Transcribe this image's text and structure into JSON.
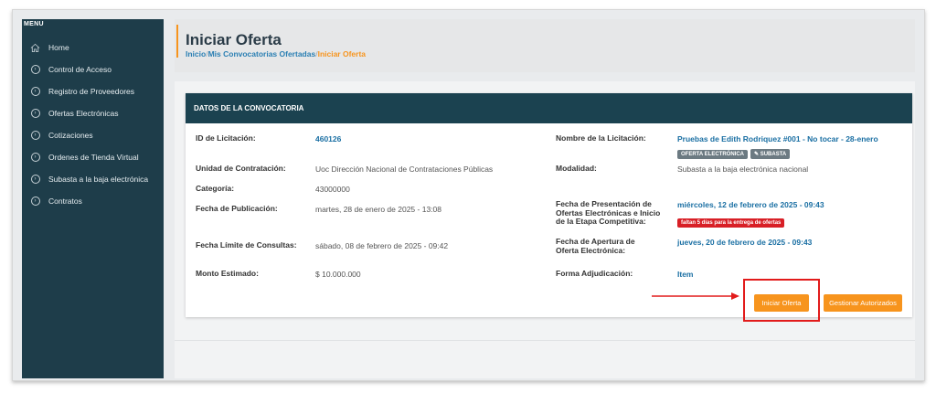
{
  "sidebar": {
    "title": "MENU",
    "items": [
      {
        "label": "Home",
        "icon": "home-icon"
      },
      {
        "label": "Control de Acceso",
        "icon": "chevron-right-circle-icon"
      },
      {
        "label": "Registro de Proveedores",
        "icon": "chevron-right-circle-icon"
      },
      {
        "label": "Ofertas Electrónicas",
        "icon": "chevron-right-circle-icon"
      },
      {
        "label": "Cotizaciones",
        "icon": "chevron-right-circle-icon"
      },
      {
        "label": "Ordenes de Tienda Virtual",
        "icon": "chevron-right-circle-icon"
      },
      {
        "label": "Subasta a la baja electrónica",
        "icon": "chevron-right-circle-icon"
      },
      {
        "label": "Contratos",
        "icon": "chevron-right-circle-icon"
      }
    ]
  },
  "header": {
    "title": "Iniciar Oferta",
    "breadcrumb": [
      "Inicio",
      "Mis Convocatorias Ofertadas",
      "Iniciar Oferta"
    ],
    "separator": "/"
  },
  "card": {
    "title": "DATOS DE LA CONVOCATORIA",
    "id_label": "ID de Licitación:",
    "id_value": "460126",
    "nombre_label": "Nombre de la Licitación:",
    "nombre_value": "Pruebas de Edith Rodriquez #001 - No tocar - 28-enero",
    "badges": [
      "OFERTA ELECTRÓNICA",
      "SUBASTA"
    ],
    "unidad_label": "Unidad de Contratación:",
    "unidad_value": "Uoc Dirección Nacional de Contrataciones Públicas",
    "modalidad_label": "Modalidad:",
    "modalidad_value": "Subasta a la baja electrónica nacional",
    "categoria_label": "Categoría:",
    "categoria_value": "43000000",
    "fecha_pub_label": "Fecha de Publicación:",
    "fecha_pub_value": "martes, 28 de enero de 2025 - 13:08",
    "fecha_pres_label": "Fecha de Presentación de Ofertas Electrónicas e Inicio de la Etapa Competitiva:",
    "fecha_pres_value": "miércoles, 12 de febrero de 2025 - 09:43",
    "faltan_badge": "faltan 5 días para la entrega de ofertas",
    "fecha_lim_label": "Fecha Límite de Consultas:",
    "fecha_lim_value": "sábado, 08 de febrero de 2025 - 09:42",
    "fecha_ap_label": "Fecha de Apertura de Oferta Electrónica:",
    "fecha_ap_value": "jueves, 20 de febrero de 2025 - 09:43",
    "monto_label": "Monto Estimado:",
    "monto_value": "$ 10.000.000",
    "forma_label": "Forma Adjudicación:",
    "forma_value": "Item"
  },
  "actions": {
    "iniciar": "Iniciar Oferta",
    "gestionar": "Gestionar Autorizados"
  },
  "colors": {
    "sidebar_bg": "#1e3d4a",
    "card_header_bg": "#1b4250",
    "accent_orange": "#f7941d",
    "link_blue": "#1a6fa3",
    "highlight_red": "#e21b1b"
  }
}
